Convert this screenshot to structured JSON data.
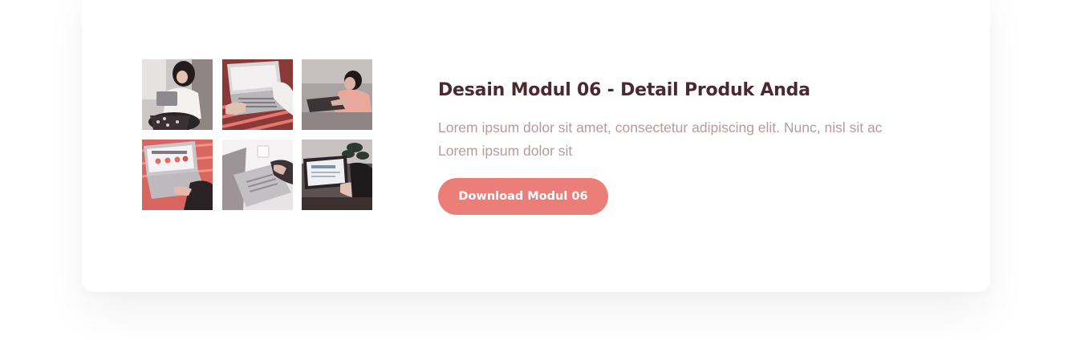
{
  "module": {
    "title": "Desain Modul 06 - Detail Produk Anda",
    "description_lines": [
      "Lorem ipsum dolor sit amet, consectetur adipiscing elit. Nunc, nisl sit ac",
      "Lorem ipsum dolor sit"
    ],
    "download_button_label": "Download Modul 06"
  },
  "gallery": {
    "photos": [
      "woman-with-laptop-photo",
      "laptop-keyboard-photo",
      "woman-typing-photo",
      "laptop-chart-screen-photo",
      "laptop-coffee-desk-photo",
      "laptop-plant-desk-photo"
    ]
  },
  "colors": {
    "title": "#4a2a30",
    "description": "#b69a9c",
    "button_bg": "#ec7e79",
    "button_text": "#ffffff",
    "photo_accent": "#e8756f"
  }
}
